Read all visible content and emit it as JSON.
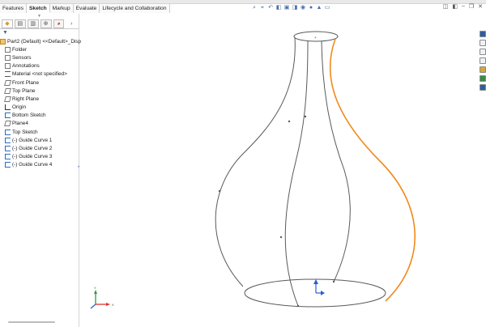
{
  "tabs": [
    "Features",
    "Sketch",
    "Markup",
    "Evaluate",
    "Lifecycle and Collaboration"
  ],
  "active_tab": "Sketch",
  "feature_tree": {
    "part": "Part2 (Default) <<Default>_Disp",
    "items": [
      {
        "label": "Folder",
        "icon": "folder-icon"
      },
      {
        "label": "Sensors",
        "icon": "sensor-icon"
      },
      {
        "label": "Annotations",
        "icon": "annotations-icon"
      },
      {
        "label": "Material <not specified>",
        "icon": "material-icon"
      },
      {
        "label": "Front Plane",
        "icon": "plane-icon"
      },
      {
        "label": "Top Plane",
        "icon": "plane-icon"
      },
      {
        "label": "Right Plane",
        "icon": "plane-icon"
      },
      {
        "label": "Origin",
        "icon": "origin-icon"
      },
      {
        "label": "Bottom Sketch",
        "icon": "sketch-icon"
      },
      {
        "label": "Plane4",
        "icon": "plane-icon"
      },
      {
        "label": "Top Sketch",
        "icon": "sketch-icon"
      },
      {
        "label": "(-) Guide Curve 1",
        "icon": "sketch-icon"
      },
      {
        "label": "(-) Guide Curve 2",
        "icon": "sketch-icon"
      },
      {
        "label": "(-) Guide Curve 3",
        "icon": "sketch-icon"
      },
      {
        "label": "(-) Guide Curve 4",
        "icon": "sketch-icon"
      }
    ]
  },
  "colors": {
    "sketch_line": "#5a5a5a",
    "selected_curve": "#f08a1c",
    "axis_x": "#d33",
    "axis_y": "#2a9d3c",
    "axis_z": "#2a5fd3",
    "sketch_icon": "#2a6cc4"
  },
  "viewport": {
    "triad_label_y": "Y",
    "triad_label_x": "X"
  }
}
